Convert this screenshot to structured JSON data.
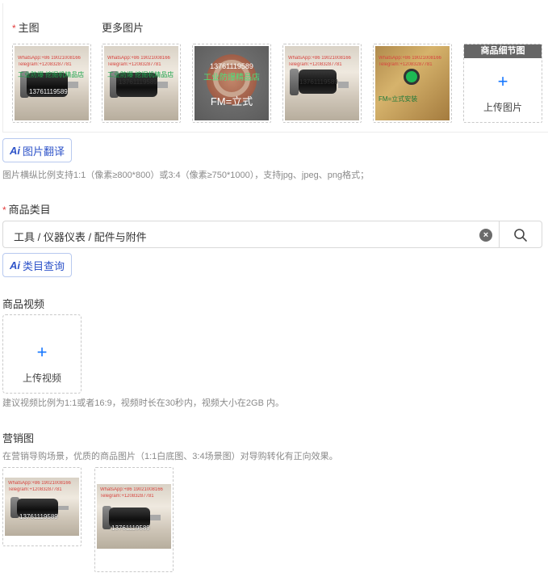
{
  "images": {
    "main_label": "主图",
    "more_label": "更多图片",
    "required_mark": "*",
    "thumbs": [
      {
        "wm1": "WhatsApp:+86 19021008166",
        "wm2": "Telegram:+12083287781",
        "wm3": "工业防爆 挖掘机精品店",
        "phone": "13761119589"
      },
      {
        "wm1": "WhatsApp:+86 19021008166",
        "wm2": "Telegram:+12083287781",
        "wm3": "工业防爆 挖掘机精品店",
        "phone": "13761119589"
      },
      {
        "phone": "13761119589",
        "shop": "工业防爆精品店",
        "label": "FM=立式"
      },
      {
        "wm1": "WhatsApp:+86 19021008166",
        "wm2": "Telegram:+12083287781",
        "phone": "13761119589"
      },
      {
        "wm1": "WhatsApp:+86 19021008166",
        "wm2": "Telegram:+12083287781",
        "label": "FM=立式安装"
      }
    ],
    "detail_title": "商品细节图",
    "upload_label": "上传图片",
    "plus_symbol": "+"
  },
  "ai_translate": {
    "ai": "Ai",
    "label": "图片翻译"
  },
  "image_hint": "图片横纵比例支持1:1（像素≥800*800）或3:4（像素≥750*1000），支持jpg、jpeg、png格式；",
  "category": {
    "required_mark": "*",
    "label": "商品类目",
    "value": "工具 / 仪器仪表 / 配件与附件",
    "clear_symbol": "×"
  },
  "ai_category": {
    "ai": "Ai",
    "label": "类目查询"
  },
  "video": {
    "label": "商品视频",
    "plus_symbol": "+",
    "upload_label": "上传视频",
    "hint": "建议视频比例为1:1或者16:9，视频时长在30秒内，视频大小在2GB 内。"
  },
  "marketing": {
    "label": "营销图",
    "hint": "在营销导购场景，优质的商品图片（1:1白底图、3:4场景图）对导购转化有正向效果。",
    "thumbs": [
      {
        "wm1": "WhatsApp:+86 19021008166",
        "wm2": "Telegram:+12083287781",
        "phone": "13761119589"
      },
      {
        "wm1": "WhatsApp:+86 19021008166",
        "wm2": "Telegram:+12083287781",
        "phone": "13761119589"
      }
    ]
  }
}
